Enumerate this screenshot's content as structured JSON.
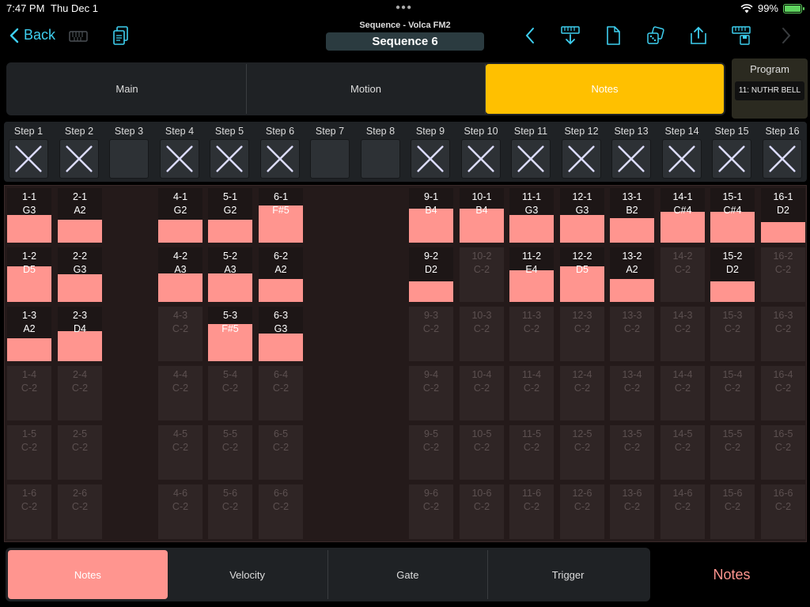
{
  "status": {
    "time": "7:47 PM",
    "date": "Thu Dec 1",
    "battery": "99%"
  },
  "nav": {
    "back_label": "Back",
    "subtitle": "Sequence - Volca FM2",
    "title": "Sequence 6"
  },
  "tabs": [
    {
      "label": "Main",
      "active": false
    },
    {
      "label": "Motion",
      "active": false
    },
    {
      "label": "Notes",
      "active": true
    }
  ],
  "program": {
    "label": "Program",
    "value": "11: NUTHR BELL"
  },
  "steps": [
    {
      "label": "Step 1",
      "checked": true
    },
    {
      "label": "Step 2",
      "checked": true
    },
    {
      "label": "Step 3",
      "checked": false
    },
    {
      "label": "Step 4",
      "checked": true
    },
    {
      "label": "Step 5",
      "checked": true
    },
    {
      "label": "Step 6",
      "checked": true
    },
    {
      "label": "Step 7",
      "checked": false
    },
    {
      "label": "Step 8",
      "checked": false
    },
    {
      "label": "Step 9",
      "checked": true
    },
    {
      "label": "Step 10",
      "checked": true
    },
    {
      "label": "Step 11",
      "checked": true
    },
    {
      "label": "Step 12",
      "checked": true
    },
    {
      "label": "Step 13",
      "checked": true
    },
    {
      "label": "Step 14",
      "checked": true
    },
    {
      "label": "Step 15",
      "checked": true
    },
    {
      "label": "Step 16",
      "checked": true
    }
  ],
  "grid": {
    "default_note": "C-2",
    "active_notes": {
      "1-1": {
        "note": "G3",
        "level": 0.5
      },
      "1-2": {
        "note": "D5",
        "level": 0.65
      },
      "1-3": {
        "note": "A2",
        "level": 0.42
      },
      "2-1": {
        "note": "A2",
        "level": 0.42
      },
      "2-2": {
        "note": "G3",
        "level": 0.5
      },
      "2-3": {
        "note": "D4",
        "level": 0.55
      },
      "4-1": {
        "note": "G2",
        "level": 0.42
      },
      "4-2": {
        "note": "A3",
        "level": 0.52
      },
      "5-1": {
        "note": "G2",
        "level": 0.42
      },
      "5-2": {
        "note": "A3",
        "level": 0.52
      },
      "5-3": {
        "note": "F#5",
        "level": 0.68
      },
      "6-1": {
        "note": "F#5",
        "level": 0.68
      },
      "6-2": {
        "note": "A2",
        "level": 0.42
      },
      "6-3": {
        "note": "G3",
        "level": 0.5
      },
      "9-1": {
        "note": "B4",
        "level": 0.62
      },
      "9-2": {
        "note": "D2",
        "level": 0.38
      },
      "10-1": {
        "note": "B4",
        "level": 0.62
      },
      "11-1": {
        "note": "G3",
        "level": 0.5
      },
      "11-2": {
        "note": "E4",
        "level": 0.58
      },
      "12-1": {
        "note": "G3",
        "level": 0.5
      },
      "12-2": {
        "note": "D5",
        "level": 0.65
      },
      "13-1": {
        "note": "B2",
        "level": 0.45
      },
      "13-2": {
        "note": "A2",
        "level": 0.42
      },
      "14-1": {
        "note": "C#4",
        "level": 0.56
      },
      "15-1": {
        "note": "C#4",
        "level": 0.56
      },
      "15-2": {
        "note": "D2",
        "level": 0.38
      },
      "16-1": {
        "note": "D2",
        "level": 0.38
      }
    }
  },
  "bottom_tabs": [
    {
      "label": "Notes",
      "active": true
    },
    {
      "label": "Velocity",
      "active": false
    },
    {
      "label": "Gate",
      "active": false
    },
    {
      "label": "Trigger",
      "active": false
    }
  ],
  "bottom_label": "Notes",
  "colors": {
    "accent": "#3ecff0",
    "active_tab": "#ffc000",
    "note": "#ff958f"
  }
}
